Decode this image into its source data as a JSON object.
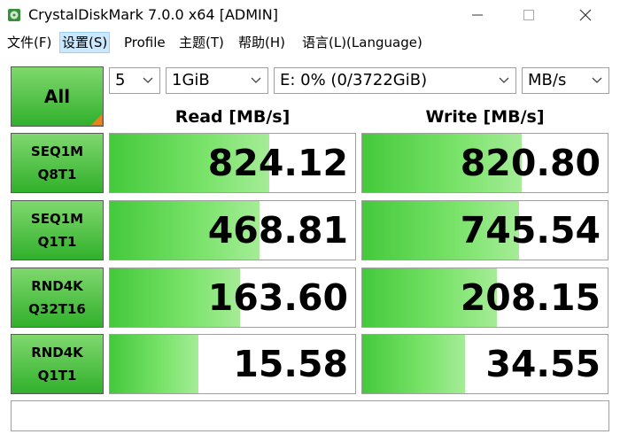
{
  "window": {
    "title": "CrystalDiskMark 7.0.0 x64 [ADMIN]"
  },
  "menu": [
    {
      "label": "文件(F)"
    },
    {
      "label": "设置(S)"
    },
    {
      "label": "Profile"
    },
    {
      "label": "主题(T)"
    },
    {
      "label": "帮助(H)"
    },
    {
      "label": "语言(L)(Language)"
    }
  ],
  "controls": {
    "all_label": "All",
    "count": "5",
    "size": "1GiB",
    "drive": "E: 0% (0/3722GiB)",
    "unit": "MB/s"
  },
  "headers": {
    "read": "Read [MB/s]",
    "write": "Write [MB/s]"
  },
  "tests": [
    {
      "line1": "SEQ1M",
      "line2": "Q8T1",
      "read": "824.12",
      "write": "820.80",
      "read_fill": 0.65,
      "write_fill": 0.65
    },
    {
      "line1": "SEQ1M",
      "line2": "Q1T1",
      "read": "468.81",
      "write": "745.54",
      "read_fill": 0.61,
      "write_fill": 0.64
    },
    {
      "line1": "RND4K",
      "line2": "Q32T16",
      "read": "163.60",
      "write": "208.15",
      "read_fill": 0.53,
      "write_fill": 0.55
    },
    {
      "line1": "RND4K",
      "line2": "Q1T1",
      "read": "15.58",
      "write": "34.55",
      "read_fill": 0.36,
      "write_fill": 0.42
    }
  ],
  "comment": "",
  "colors": {
    "accent_green": "#31b02c",
    "corner_orange": "#e8831f",
    "menu_highlight": "#cce8ff"
  },
  "icons": {
    "app": "disk-icon",
    "minimize": "minimize-icon",
    "maximize": "maximize-icon",
    "close": "close-icon",
    "dropdown": "chevron-down-icon"
  }
}
